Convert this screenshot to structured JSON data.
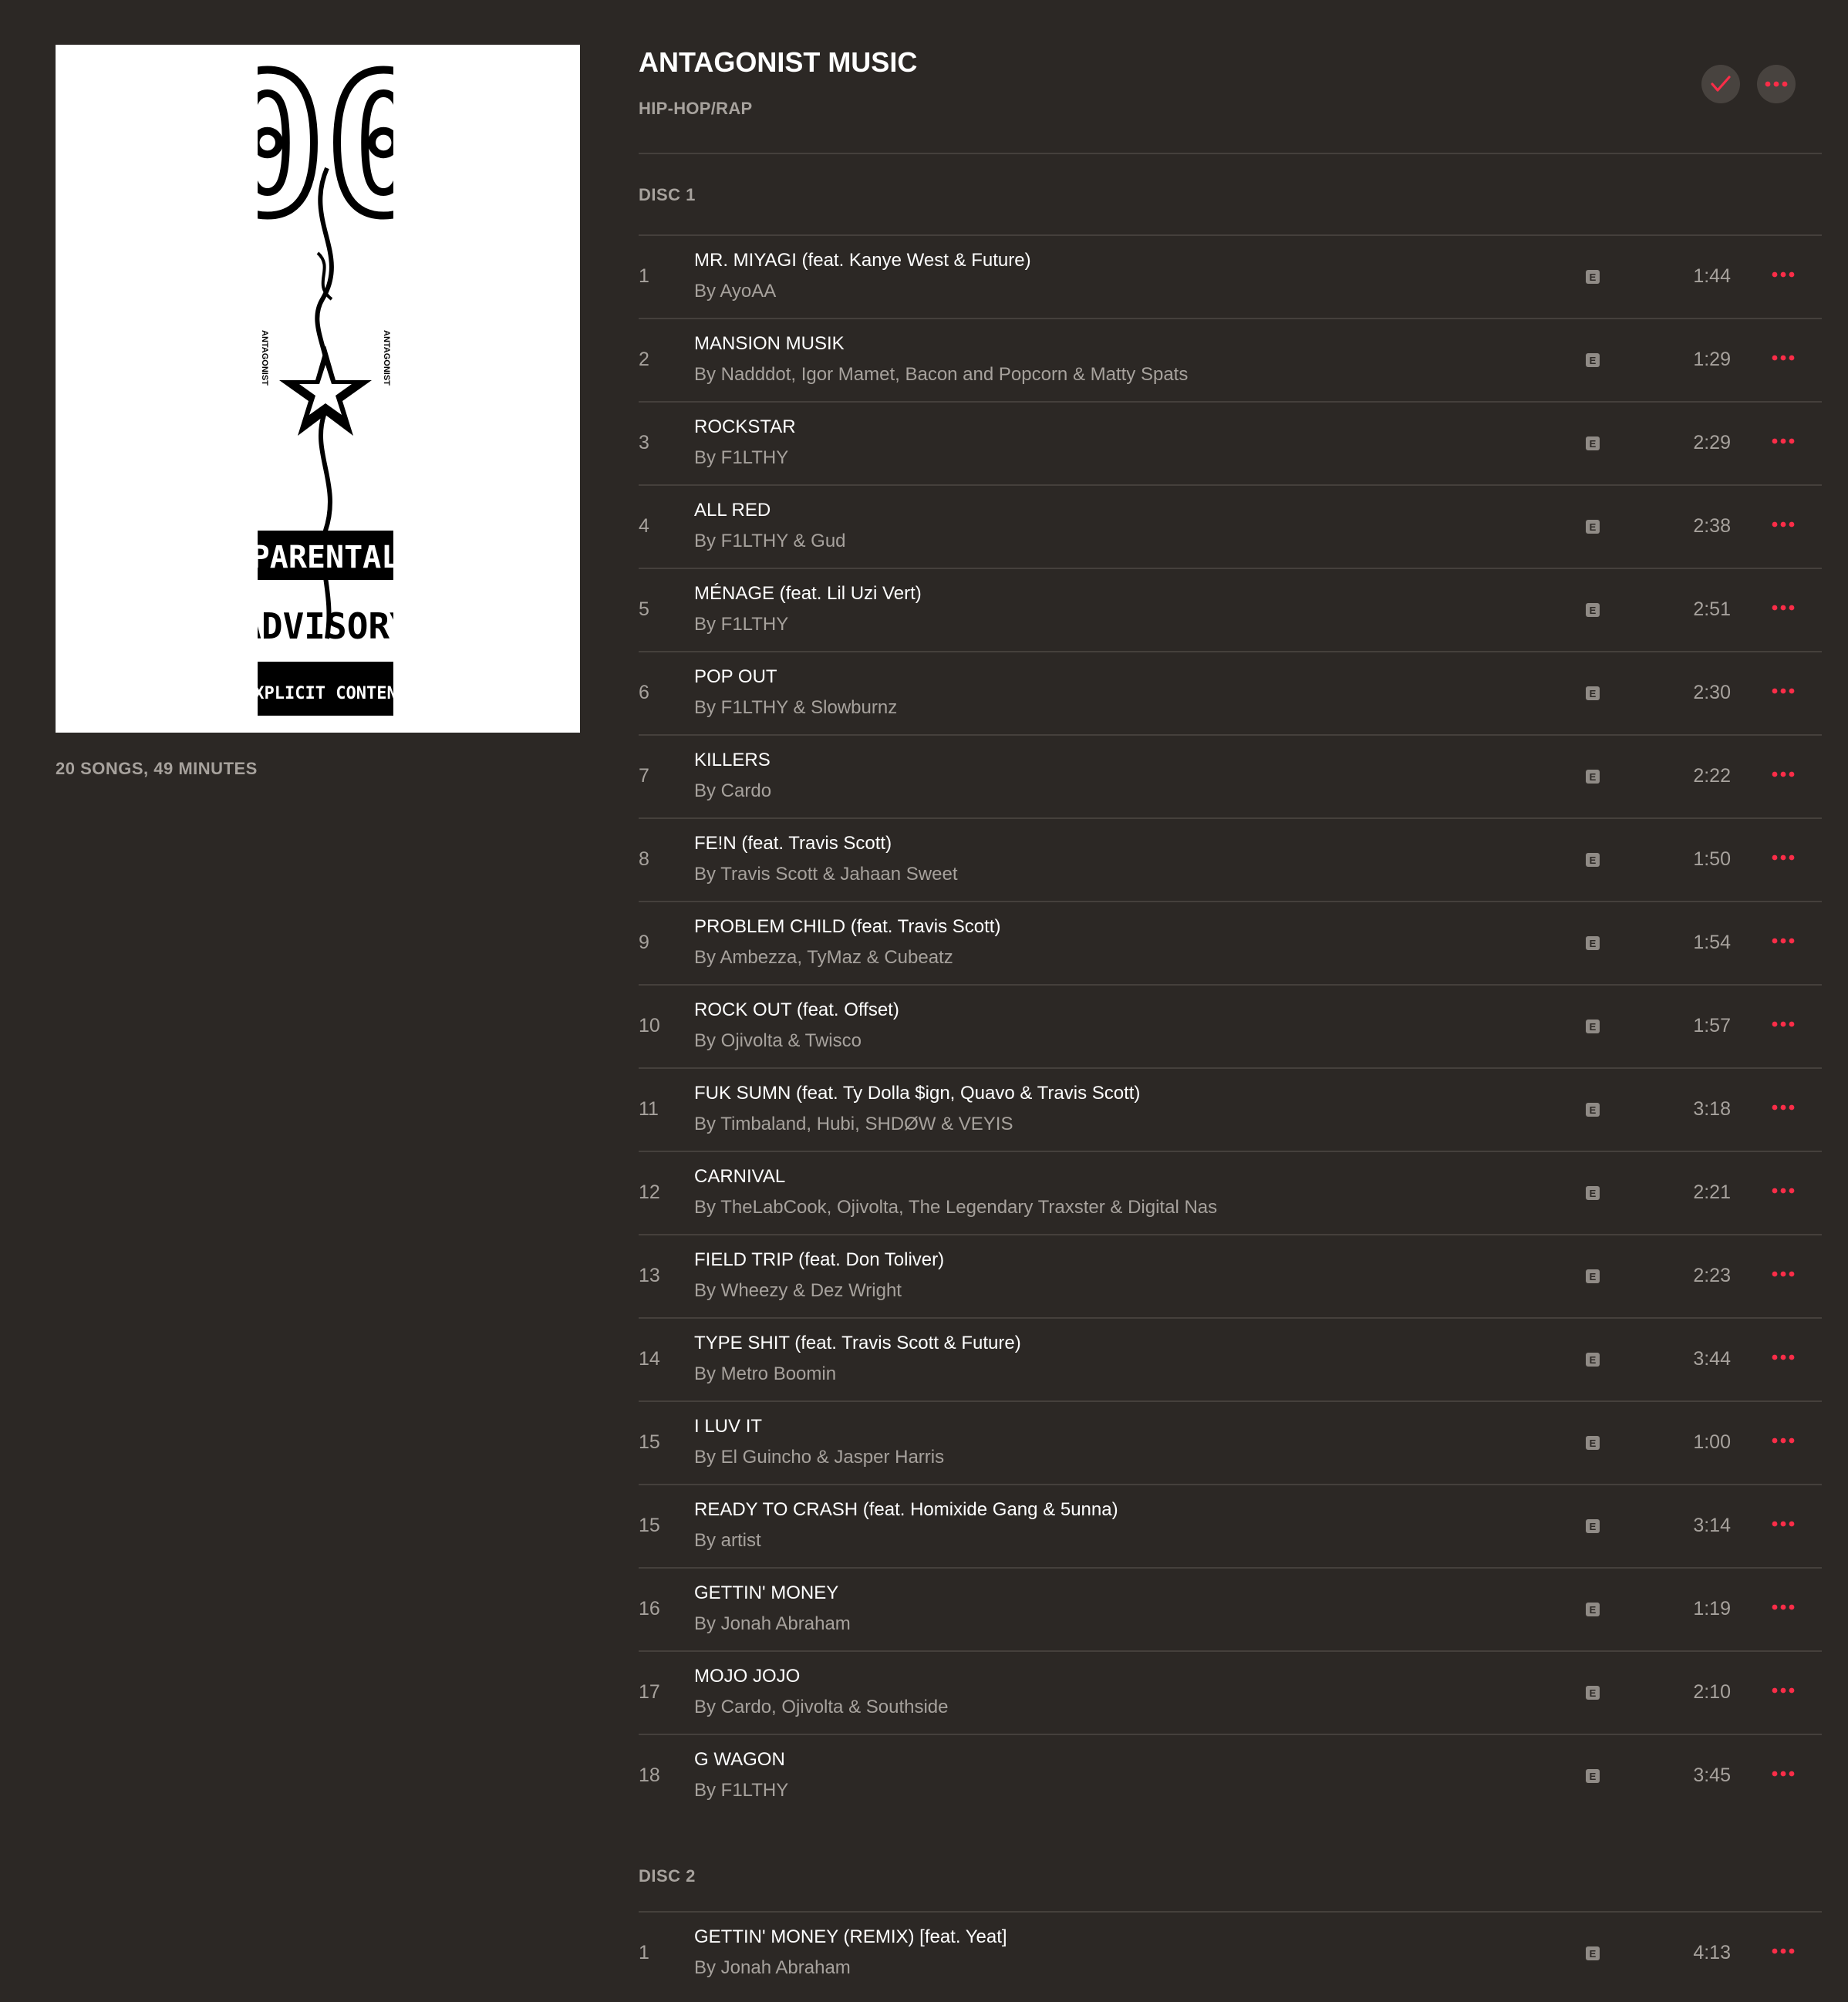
{
  "album": {
    "title": "ANTAGONIST MUSIC",
    "genre": "HIP-HOP/RAP",
    "stats": "20 SONGS, 49 MINUTES",
    "cover_text": {
      "big": "00",
      "line1": "PARENTAL",
      "line2": "ADVISORY",
      "line3": "EXPLICIT CONTENT",
      "side": "ANTAGONIST"
    }
  },
  "icons": {
    "check": "checkmark-icon",
    "more": "more-options-icon",
    "explicit": "explicit-badge"
  },
  "colors": {
    "accent": "#fa2d48",
    "background": "#2c2825",
    "muted": "#a7a29d"
  },
  "explicit_label": "E",
  "discs": [
    {
      "label": "DISC 1",
      "tracks": [
        {
          "num": "1",
          "title": "MR. MIYAGI (feat. Kanye West & Future)",
          "artist": "By AyoAA",
          "duration": "1:44"
        },
        {
          "num": "2",
          "title": "MANSION MUSIK",
          "artist": "By Nadddot, Igor Mamet, Bacon and Popcorn & Matty Spats",
          "duration": "1:29"
        },
        {
          "num": "3",
          "title": "ROCKSTAR",
          "artist": "By F1LTHY",
          "duration": "2:29"
        },
        {
          "num": "4",
          "title": "ALL RED",
          "artist": "By F1LTHY & Gud",
          "duration": "2:38"
        },
        {
          "num": "5",
          "title": "MÉNAGE (feat. Lil Uzi Vert)",
          "artist": "By F1LTHY",
          "duration": "2:51"
        },
        {
          "num": "6",
          "title": "POP OUT",
          "artist": "By F1LTHY & Slowburnz",
          "duration": "2:30"
        },
        {
          "num": "7",
          "title": "KILLERS",
          "artist": "By Cardo",
          "duration": "2:22"
        },
        {
          "num": "8",
          "title": "FE!N (feat. Travis Scott)",
          "artist": "By Travis Scott & Jahaan Sweet",
          "duration": "1:50"
        },
        {
          "num": "9",
          "title": "PROBLEM CHILD (feat. Travis Scott)",
          "artist": "By Ambezza, TyMaz & Cubeatz",
          "duration": "1:54"
        },
        {
          "num": "10",
          "title": "ROCK OUT (feat. Offset)",
          "artist": "By Ojivolta & Twisco",
          "duration": "1:57"
        },
        {
          "num": "11",
          "title": "FUK SUMN (feat. Ty Dolla $ign, Quavo & Travis Scott)",
          "artist": "By Timbaland, Hubi, SHDØW & VEYIS",
          "duration": "3:18"
        },
        {
          "num": "12",
          "title": "CARNIVAL",
          "artist": "By TheLabCook, Ojivolta, The Legendary Traxster & Digital Nas",
          "duration": "2:21"
        },
        {
          "num": "13",
          "title": "FIELD TRIP (feat. Don Toliver)",
          "artist": "By Wheezy & Dez Wright",
          "duration": "2:23"
        },
        {
          "num": "14",
          "title": "TYPE SHIT (feat. Travis Scott & Future)",
          "artist": "By Metro Boomin",
          "duration": "3:44"
        },
        {
          "num": "15",
          "title": "I LUV IT",
          "artist": "By El Guincho & Jasper Harris",
          "duration": "1:00"
        },
        {
          "num": "15",
          "title": "READY TO CRASH (feat. Homixide Gang & 5unna)",
          "artist": "By artist",
          "duration": "3:14"
        },
        {
          "num": "16",
          "title": "GETTIN' MONEY",
          "artist": "By Jonah Abraham",
          "duration": "1:19"
        },
        {
          "num": "17",
          "title": "MOJO JOJO",
          "artist": "By Cardo, Ojivolta & Southside",
          "duration": "2:10"
        },
        {
          "num": "18",
          "title": "G WAGON",
          "artist": "By F1LTHY",
          "duration": "3:45"
        }
      ]
    },
    {
      "label": "DISC 2",
      "tracks": [
        {
          "num": "1",
          "title": "GETTIN' MONEY (REMIX) [feat. Yeat]",
          "artist": "By Jonah Abraham",
          "duration": "4:13"
        }
      ]
    }
  ]
}
